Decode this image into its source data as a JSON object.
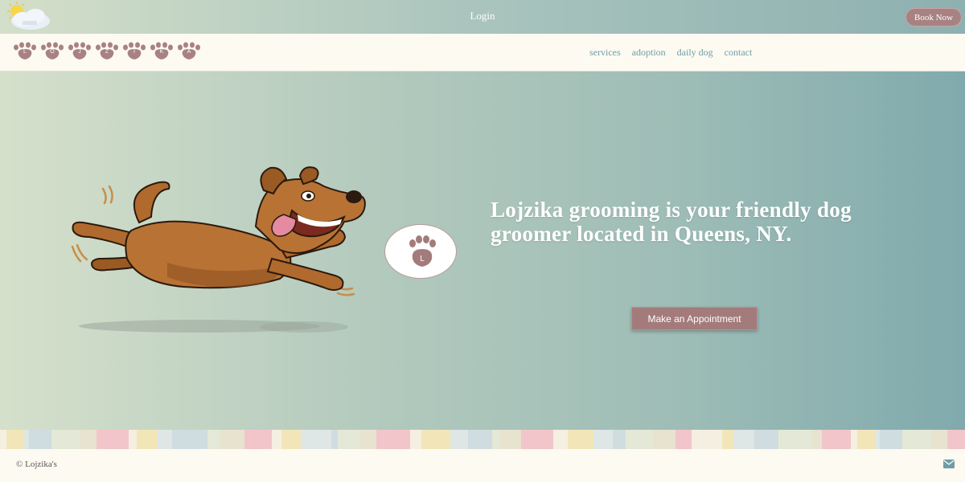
{
  "topbar": {
    "weather_icon": "sun-cloud-icon",
    "login_label": "Login",
    "book_label": "Book Now"
  },
  "logo": {
    "letters": [
      "L",
      "O",
      "J",
      "Z",
      "I",
      "K",
      "A"
    ],
    "icon": "paw-icon",
    "color": "#a88282"
  },
  "nav": {
    "items": [
      {
        "label": "services"
      },
      {
        "label": "adoption"
      },
      {
        "label": "daily dog"
      },
      {
        "label": "contact"
      }
    ]
  },
  "hero": {
    "illustration": "running-dog-illustration",
    "badge_letter": "L",
    "badge_icon": "paw-icon",
    "title": "Lojzika grooming is your friendly dog groomer located in Queens, NY.",
    "cta_label": "Make an Appointment"
  },
  "footer": {
    "copyright": "© Lojzika's",
    "mail_icon": "envelope-icon"
  },
  "colors": {
    "accent": "#a37b7b",
    "link": "#6f9da6",
    "background": "#fdfaf2"
  }
}
